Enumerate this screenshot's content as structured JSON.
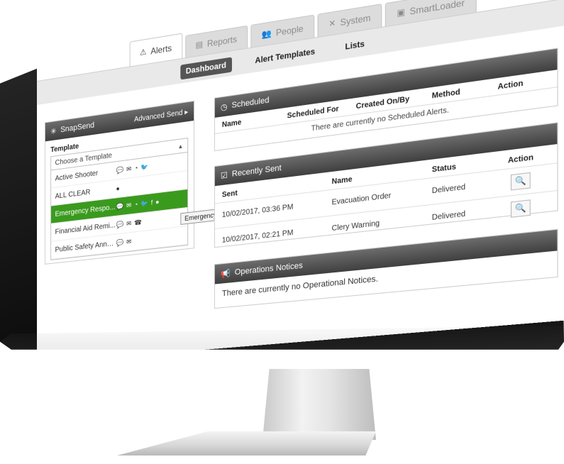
{
  "nav": {
    "tabs": [
      {
        "label": "Alerts",
        "icon": "warning-icon",
        "active": true
      },
      {
        "label": "Reports",
        "icon": "report-icon",
        "active": false
      },
      {
        "label": "People",
        "icon": "people-icon",
        "active": false
      },
      {
        "label": "System",
        "icon": "tools-icon",
        "active": false
      },
      {
        "label": "SmartLoader",
        "icon": "loader-icon",
        "active": false
      }
    ],
    "subnav": [
      {
        "label": "Dashboard",
        "active": true
      },
      {
        "label": "Alert Templates",
        "active": false
      },
      {
        "label": "Lists",
        "active": false
      }
    ]
  },
  "snapsend": {
    "title": "SnapSend",
    "advanced_link": "Advanced Send ▸",
    "template_label": "Template",
    "select_value": "Choose a Template",
    "templates": [
      {
        "name": "Active Shooter",
        "icons": [
          "chat-icon",
          "email-icon",
          "rss-icon",
          "twitter-icon"
        ],
        "selected": false
      },
      {
        "name": "ALL CLEAR",
        "icons": [
          "desktop-alert-icon"
        ],
        "selected": false
      },
      {
        "name": "Emergency Respo...",
        "icons": [
          "chat-icon",
          "email-icon",
          "rss-icon",
          "twitter-icon",
          "facebook-icon",
          "desktop-alert-icon"
        ],
        "selected": true
      },
      {
        "name": "Financial Aid Remi...",
        "icons": [
          "chat-icon",
          "email-icon",
          "phone-icon"
        ],
        "selected": false
      },
      {
        "name": "Public Safety Anno...",
        "icons": [
          "chat-icon",
          "email-icon"
        ],
        "selected": false
      }
    ],
    "tooltip": "Emergency Response Team Alert"
  },
  "scheduled": {
    "title": "Scheduled",
    "columns": [
      "Name",
      "Scheduled For",
      "Created On/By",
      "Method",
      "Action"
    ],
    "empty": "There are currently no Scheduled Alerts."
  },
  "recent": {
    "title": "Recently Sent",
    "columns": [
      "Sent",
      "Name",
      "Status",
      "Action"
    ],
    "rows": [
      {
        "sent": "10/02/2017, 03:36 PM",
        "name": "Evacuation Order",
        "status": "Delivered"
      },
      {
        "sent": "10/02/2017, 02:21 PM",
        "name": "Clery Warning",
        "status": "Delivered"
      }
    ]
  },
  "ops": {
    "title": "Operations Notices",
    "empty": "There are currently no Operational Notices."
  },
  "colors": {
    "selected_green": "#3a9a1e",
    "panel_header": "#4a4a4a"
  }
}
